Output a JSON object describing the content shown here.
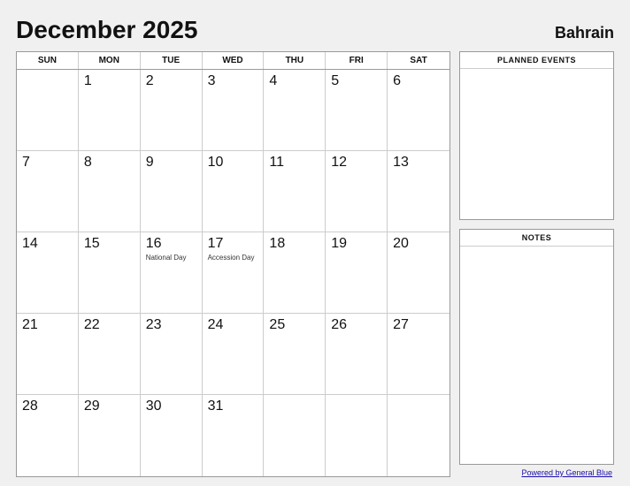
{
  "header": {
    "title": "December 2025",
    "country": "Bahrain"
  },
  "day_headers": [
    "SUN",
    "MON",
    "TUE",
    "WED",
    "THU",
    "FRI",
    "SAT"
  ],
  "cells": [
    {
      "day": "",
      "events": []
    },
    {
      "day": "1",
      "events": []
    },
    {
      "day": "2",
      "events": []
    },
    {
      "day": "3",
      "events": []
    },
    {
      "day": "4",
      "events": []
    },
    {
      "day": "5",
      "events": []
    },
    {
      "day": "6",
      "events": []
    },
    {
      "day": "7",
      "events": []
    },
    {
      "day": "8",
      "events": []
    },
    {
      "day": "9",
      "events": []
    },
    {
      "day": "10",
      "events": []
    },
    {
      "day": "11",
      "events": []
    },
    {
      "day": "12",
      "events": []
    },
    {
      "day": "13",
      "events": []
    },
    {
      "day": "14",
      "events": []
    },
    {
      "day": "15",
      "events": []
    },
    {
      "day": "16",
      "events": [
        "National Day"
      ]
    },
    {
      "day": "17",
      "events": [
        "Accession Day"
      ]
    },
    {
      "day": "18",
      "events": []
    },
    {
      "day": "19",
      "events": []
    },
    {
      "day": "20",
      "events": []
    },
    {
      "day": "21",
      "events": []
    },
    {
      "day": "22",
      "events": []
    },
    {
      "day": "23",
      "events": []
    },
    {
      "day": "24",
      "events": []
    },
    {
      "day": "25",
      "events": []
    },
    {
      "day": "26",
      "events": []
    },
    {
      "day": "27",
      "events": []
    },
    {
      "day": "28",
      "events": []
    },
    {
      "day": "29",
      "events": []
    },
    {
      "day": "30",
      "events": []
    },
    {
      "day": "31",
      "events": []
    },
    {
      "day": "",
      "events": []
    },
    {
      "day": "",
      "events": []
    },
    {
      "day": "",
      "events": []
    }
  ],
  "sidebar": {
    "planned_events_label": "PLANNED EVENTS",
    "notes_label": "NOTES"
  },
  "footer": {
    "link_text": "Powered by General Blue"
  }
}
